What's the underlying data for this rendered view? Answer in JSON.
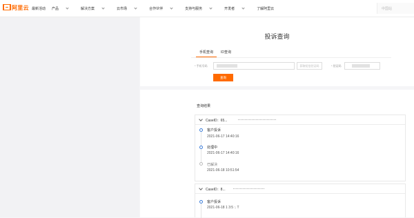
{
  "nav": {
    "logo_text": "阿里云",
    "links": [
      "最新活动",
      "产品",
      "解决方案",
      "云市场",
      "合作伙伴",
      "支持与服务",
      "开发者",
      "了解阿里云"
    ],
    "right_text": "中国站"
  },
  "page": {
    "title": "投诉查询",
    "tabs": [
      "手机查询",
      "ID查询"
    ],
    "phone_label": "* 手机号码",
    "captcha_button": "获取短信验证码",
    "code_label": "* 验证码",
    "query_button": "查询"
  },
  "results": {
    "title": "查询结果",
    "cases": [
      {
        "case_label": "CaseID：65...",
        "events": [
          {
            "status": "客户投诉",
            "time": "2021-06-17 14:40:16"
          },
          {
            "status": "处理中",
            "time": "2021-06-17 14:40:16"
          },
          {
            "status": "已解决",
            "time": "2021-06-18 10:51:54"
          }
        ]
      },
      {
        "case_label": "CaseID：8...",
        "events": [
          {
            "status": "客户投诉",
            "time": "2021-06-18 1 3:5  :. T"
          }
        ]
      }
    ]
  },
  "colors": {
    "accent": "#ff6a00",
    "timeline_dot": "#3b7dd8"
  }
}
